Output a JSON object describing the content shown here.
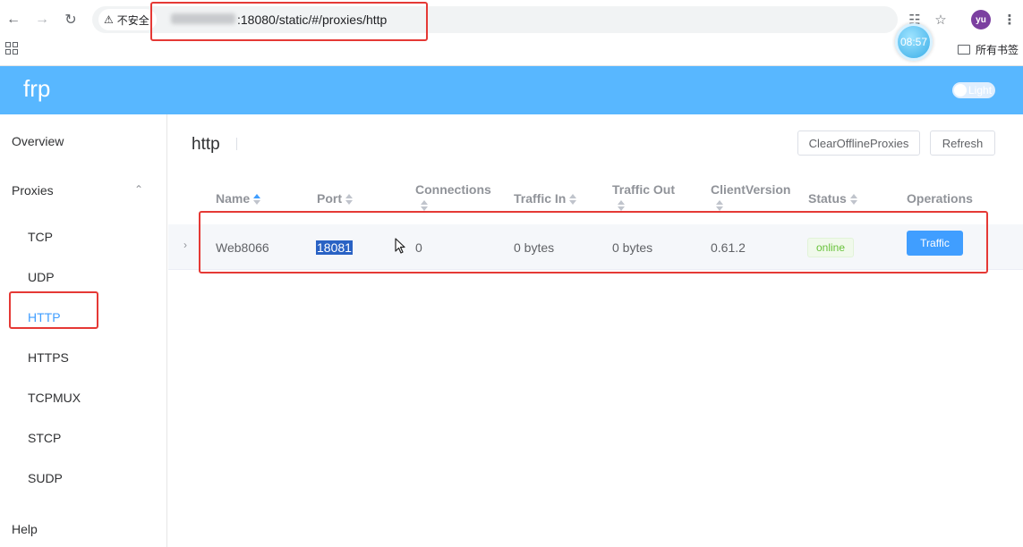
{
  "browser": {
    "security_label": "不安全",
    "url_suffix": ":18080/static/#/proxies/http",
    "avatar_initials": "yu",
    "clock_time": "08:57",
    "bookmarks_label": "所有书签"
  },
  "header": {
    "brand": "frp",
    "theme_label": "Light",
    "color": "#58b7ff"
  },
  "sidebar": {
    "overview": "Overview",
    "proxies": "Proxies",
    "items": [
      "TCP",
      "UDP",
      "HTTP",
      "HTTPS",
      "TCPMUX",
      "STCP",
      "SUDP"
    ],
    "active": "HTTP",
    "help": "Help"
  },
  "main": {
    "title": "http",
    "clear_button": "ClearOfflineProxies",
    "refresh_button": "Refresh",
    "columns": {
      "name": "Name",
      "port": "Port",
      "connections": "Connections",
      "traffic_in": "Traffic In",
      "traffic_out": "Traffic Out",
      "client_version": "ClientVersion",
      "status": "Status",
      "operations": "Operations"
    },
    "rows": [
      {
        "name": "Web8066",
        "port": "18081",
        "connections": "0",
        "traffic_in": "0 bytes",
        "traffic_out": "0 bytes",
        "client_version": "0.61.2",
        "status": "online",
        "action": "Traffic"
      }
    ]
  }
}
